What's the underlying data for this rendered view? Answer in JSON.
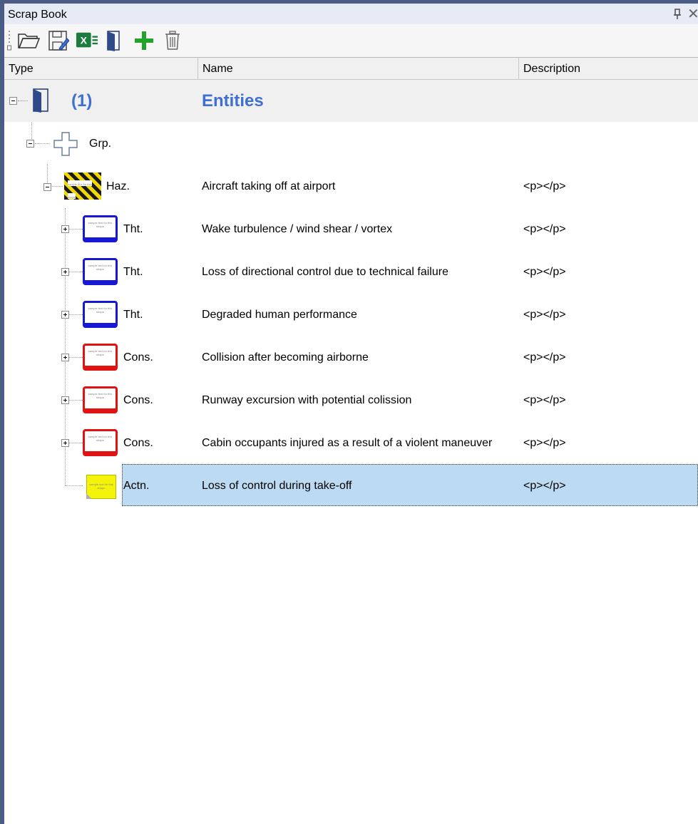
{
  "panel": {
    "title": "Scrap Book"
  },
  "toolbar": {
    "buttons": [
      "open-folder-icon",
      "save-icon",
      "excel-export-icon",
      "door-icon",
      "add-icon",
      "trash-icon"
    ]
  },
  "columns": {
    "type": "Type",
    "name": "Name",
    "description": "Description"
  },
  "root": {
    "count": "(1)",
    "name": "Entities"
  },
  "group": {
    "type": "Grp."
  },
  "hazard": {
    "type": "Haz.",
    "name": "Aircraft taking off at airport",
    "description": "<p></p>"
  },
  "children": [
    {
      "type": "Tht.",
      "name": "Wake turbulence / wind shear / vortex",
      "description": "<p></p>",
      "color": "#1717d6"
    },
    {
      "type": "Tht.",
      "name": "Loss of directional control due to technical failure",
      "description": "<p></p>",
      "color": "#1717d6"
    },
    {
      "type": "Tht.",
      "name": "Degraded human performance",
      "description": "<p></p>",
      "color": "#1717d6"
    },
    {
      "type": "Cons.",
      "name": "Collision after becoming airborne",
      "description": "<p></p>",
      "color": "#e11212"
    },
    {
      "type": "Cons.",
      "name": "Runway excursion with potential colission",
      "description": "<p></p>",
      "color": "#e11212"
    },
    {
      "type": "Cons.",
      "name": "Cabin occupants injured as a result of a violent maneuver",
      "description": "<p></p>",
      "color": "#e11212"
    },
    {
      "type": "Actn.",
      "name": "Loss of control during take-off",
      "description": "<p></p>",
      "color": "#f4f40a"
    }
  ],
  "shape_sample_text": "sample text for this shape",
  "colors": {
    "accent": "#3f6fd1",
    "selection": "#bcdaf1",
    "frame": "#4a5b85"
  }
}
